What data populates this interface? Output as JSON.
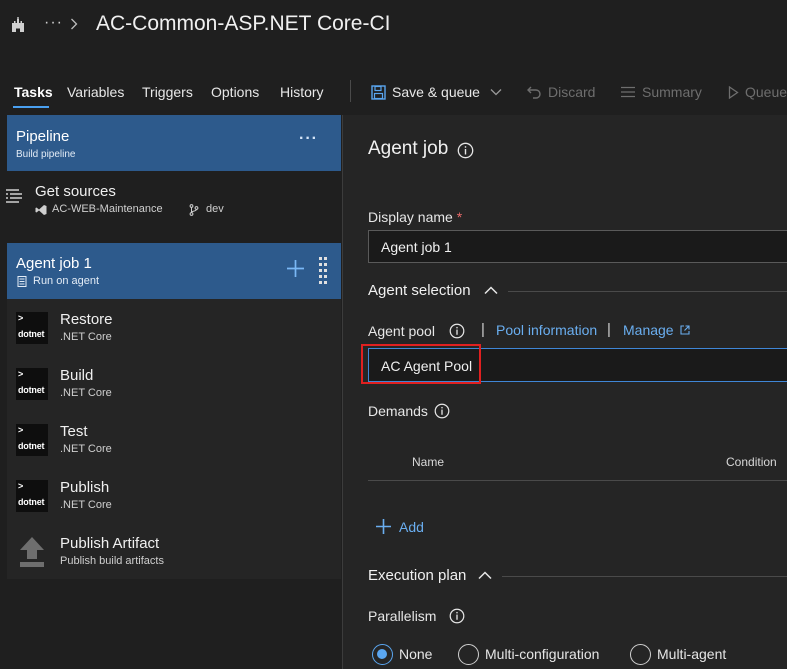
{
  "header": {
    "title": "AC-Common-ASP.NET Core-CI",
    "app_icon": "castle-icon",
    "breadcrumb_more": "···"
  },
  "tabs": [
    {
      "label": "Tasks",
      "active": true
    },
    {
      "label": "Variables"
    },
    {
      "label": "Triggers"
    },
    {
      "label": "Options"
    },
    {
      "label": "History"
    }
  ],
  "toolbar": {
    "save_queue": "Save & queue",
    "discard": "Discard",
    "summary": "Summary",
    "queue": "Queue"
  },
  "pipeline": {
    "title": "Pipeline",
    "subtitle": "Build pipeline",
    "more": "···"
  },
  "get_sources": {
    "title": "Get sources",
    "repo": "AC-WEB-Maintenance",
    "branch": "dev"
  },
  "agent_job": {
    "title": "Agent job 1",
    "subtitle": "Run on agent"
  },
  "tasks": [
    {
      "title": "Restore",
      "subtitle": ".NET Core",
      "icon_chevron": ">",
      "icon_label": "dotnet"
    },
    {
      "title": "Build",
      "subtitle": ".NET Core",
      "icon_chevron": ">",
      "icon_label": "dotnet"
    },
    {
      "title": "Test",
      "subtitle": ".NET Core",
      "icon_chevron": ">",
      "icon_label": "dotnet"
    },
    {
      "title": "Publish",
      "subtitle": ".NET Core",
      "icon_chevron": ">",
      "icon_label": "dotnet"
    },
    {
      "title": "Publish Artifact",
      "subtitle": "Publish build artifacts"
    }
  ],
  "details": {
    "heading": "Agent job",
    "display_name_label": "Display name",
    "required_mark": "*",
    "display_name_value": "Agent job 1",
    "agent_selection_title": "Agent selection",
    "agent_pool_label": "Agent pool",
    "pool_information_link": "Pool information",
    "manage_link": "Manage",
    "separator": "|",
    "agent_pool_value": "AC Agent Pool",
    "demands_label": "Demands",
    "demands_columns": {
      "name": "Name",
      "condition": "Condition"
    },
    "add_label": "Add",
    "execution_plan_title": "Execution plan",
    "parallelism_label": "Parallelism",
    "parallelism_options": [
      {
        "label": "None",
        "selected": true
      },
      {
        "label": "Multi-configuration",
        "selected": false
      },
      {
        "label": "Multi-agent",
        "selected": false
      }
    ]
  },
  "colors": {
    "accent": "#4aa0f0",
    "selected_card": "#2d5a8c",
    "highlight_box": "#e02020",
    "link": "#6aaef0"
  }
}
